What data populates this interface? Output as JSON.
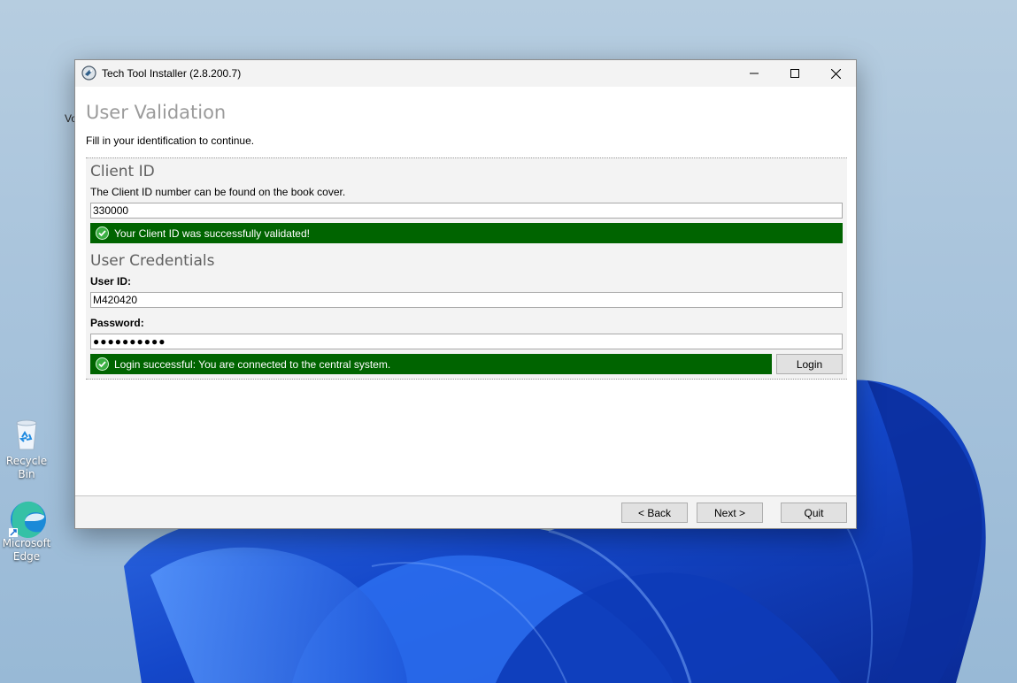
{
  "window": {
    "title": "Tech Tool Installer (2.8.200.7)"
  },
  "page": {
    "title": "User Validation",
    "subtitle": "Fill in your identification to continue."
  },
  "client_section": {
    "heading": "Client ID",
    "hint": "The Client ID number can be found on the book cover.",
    "client_id_value": "330000",
    "success_message": "Your Client ID was successfully validated!"
  },
  "credentials_section": {
    "heading": "User Credentials",
    "user_id_label": "User ID:",
    "user_id_value": "M420420",
    "password_label": "Password:",
    "password_value": "●●●●●●●●●●",
    "success_message": "Login successful: You are connected to the central system.",
    "login_label": "Login"
  },
  "footer": {
    "back_label": "< Back",
    "next_label": "Next >",
    "quit_label": "Quit"
  },
  "desktop": {
    "partial_label": "Vo",
    "recycle_bin_label": "Recycle Bin",
    "edge_label_line1": "Microsoft",
    "edge_label_line2": "Edge"
  },
  "colors": {
    "success_banner": "#006400",
    "heading_gray": "#9b9b9b"
  }
}
